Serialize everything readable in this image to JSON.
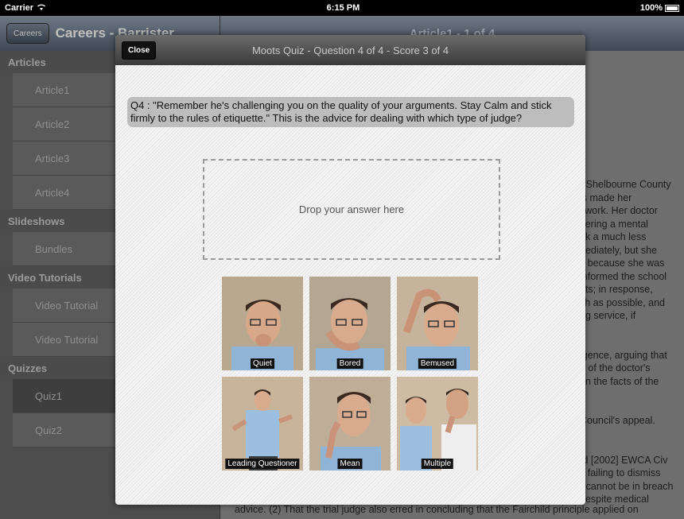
{
  "status": {
    "carrier": "Carrier",
    "time": "6:15 PM",
    "battery": "100%"
  },
  "sidebar": {
    "back_label": "Careers",
    "title": "Careers - Barrister",
    "sections": [
      {
        "header": "Articles",
        "items": [
          "Article1",
          "Article2",
          "Article3",
          "Article4"
        ]
      },
      {
        "header": "Slideshows",
        "items": [
          "Bundles"
        ]
      },
      {
        "header": "Video Tutorials",
        "items": [
          "Video Tutorial",
          "Video Tutorial"
        ]
      },
      {
        "header": "Quizzes",
        "items": [
          "Quiz1",
          "Quiz2"
        ]
      }
    ]
  },
  "detail": {
    "title": "Article1 - 1 of 4",
    "text_lines": [
      "r Shelbourne County",
      "is made her",
      "l work. Her doctor",
      "ffering a mental",
      "ek a much less",
      "nediately, but she",
      "y because she was",
      "informed the school",
      "nts; in response,",
      "ch as possible, and",
      "ng service, if",
      "",
      "",
      "igence, arguing that",
      "e of the doctor's",
      "on the facts of the",
      "",
      "",
      "Council's appeal.",
      "",
      "",
      "td [2002] EWCA Civ",
      "y failing to dismiss",
      "r cannot be in breach",
      "despite medical"
    ],
    "bottom_line": "advice. (2) That the trial judge also erred in concluding that the Fairchild principle applied on"
  },
  "modal": {
    "close_label": "Close",
    "title": "Moots Quiz - Question 4 of 4 - Score 3 of 4",
    "question": "Q4 : \"Remember he's challenging you on the quality of your arguments. Stay  Calm and stick firmly to the rules of etiquette.\" This is the advice for dealing with which type of judge?",
    "dropzone": "Drop your answer here",
    "answers": [
      "Quiet",
      "Bored",
      "Bemused",
      "Leading Questioner",
      "Mean",
      "Multiple"
    ]
  },
  "colors": {
    "modal_bar": "#4a4a4a",
    "question_bg": "#bdbdbd",
    "label_bg": "#111111"
  }
}
